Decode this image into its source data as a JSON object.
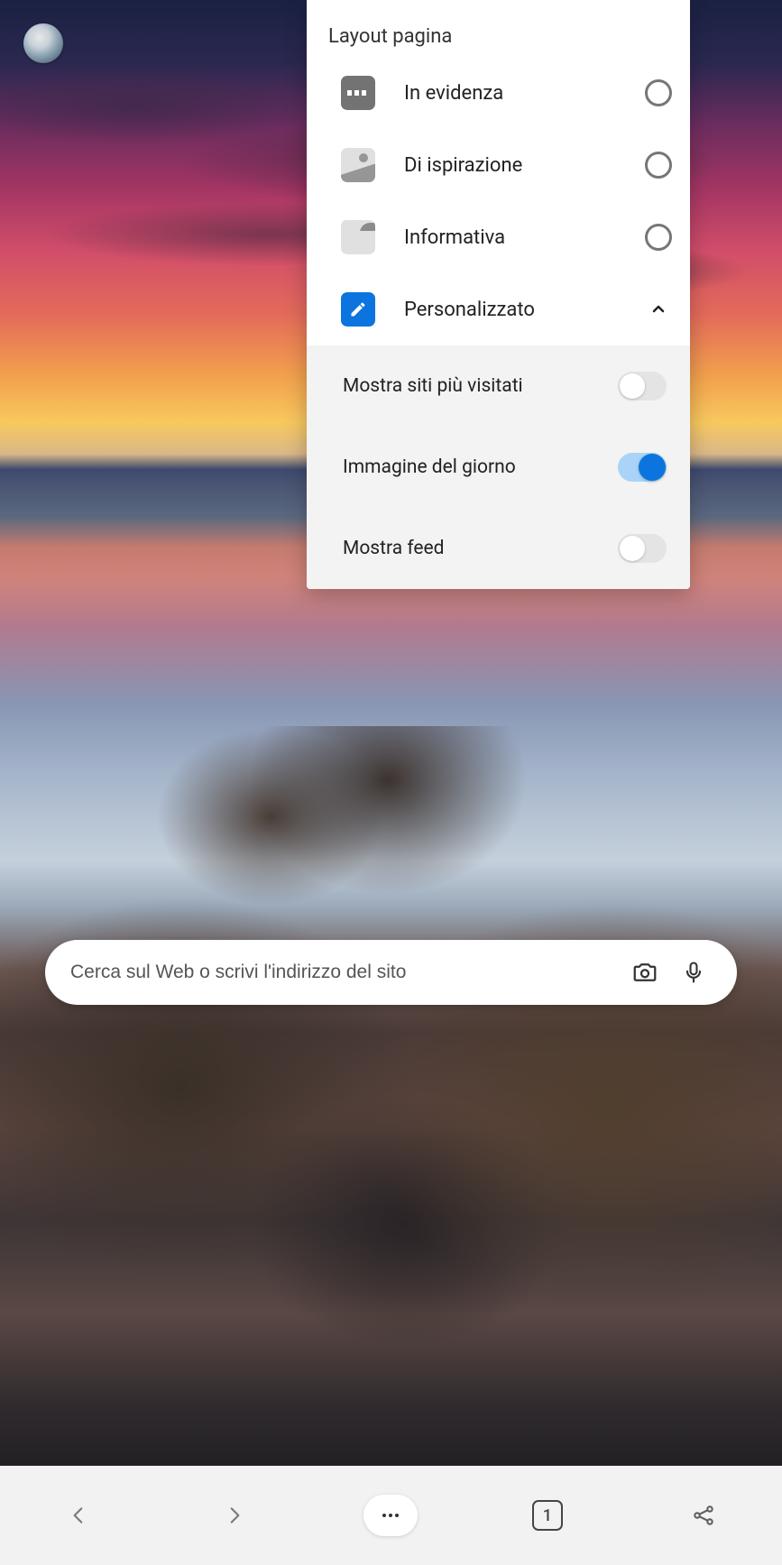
{
  "popover": {
    "title": "Layout pagina",
    "options": [
      {
        "label": "In evidenza",
        "selected": false
      },
      {
        "label": "Di ispirazione",
        "selected": false
      },
      {
        "label": "Informativa",
        "selected": false
      },
      {
        "label": "Personalizzato",
        "selected": true
      }
    ],
    "toggles": [
      {
        "label": "Mostra siti più visitati",
        "on": false
      },
      {
        "label": "Immagine del giorno",
        "on": true
      },
      {
        "label": "Mostra feed",
        "on": false
      }
    ]
  },
  "search": {
    "placeholder": "Cerca sul Web o scrivi l'indirizzo del sito"
  },
  "bottombar": {
    "tab_count": "1"
  },
  "colors": {
    "accent": "#0b74de"
  }
}
